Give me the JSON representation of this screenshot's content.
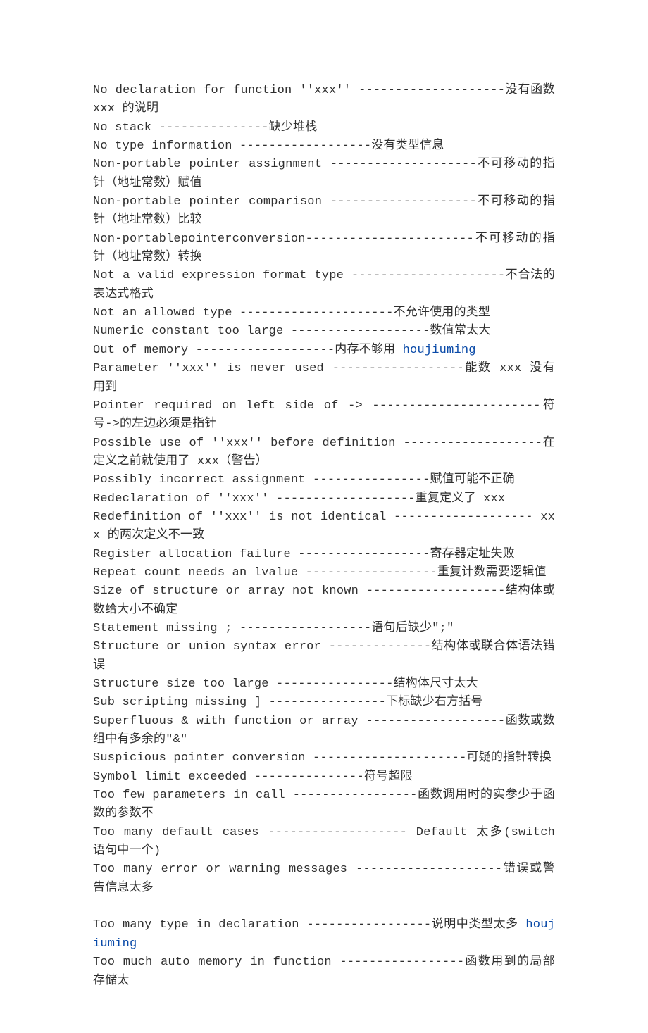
{
  "lines": [
    {
      "text": "No declaration for function ''xxx'' --------------------没有函数 xxx 的说明"
    },
    {
      "text": "No stack ---------------缺少堆栈"
    },
    {
      "text": "No type information ------------------没有类型信息"
    },
    {
      "text": "Non-portable pointer assignment --------------------不可移动的指针（地址常数）赋值"
    },
    {
      "text": "Non-portable pointer comparison --------------------不可移动的指针（地址常数）比较"
    },
    {
      "text": "Non-portablepointerconversion-----------------------不可移动的指针（地址常数）转换"
    },
    {
      "text": "Not a valid expression format type ---------------------不合法的表达式格式"
    },
    {
      "text": "Not an allowed type ---------------------不允许使用的类型"
    },
    {
      "text": "Numeric constant too large -------------------数值常太大"
    },
    {
      "text": "Out of memory -------------------内存不够用 ",
      "link": "houjiuming"
    },
    {
      "text": "Parameter ''xxx'' is never used ------------------能数 xxx 没有用到"
    },
    {
      "text": "Pointer required on left side of -> -----------------------符号->的左边必须是指针"
    },
    {
      "text": "Possible use of ''xxx'' before definition -------------------在定义之前就使用了 xxx（警告）"
    },
    {
      "text": "Possibly incorrect assignment ----------------赋值可能不正确"
    },
    {
      "text": "Redeclaration of ''xxx'' -------------------重复定义了 xxx"
    },
    {
      "text": "Redefinition of ''xxx'' is not identical ------------------- xxx 的两次定义不一致"
    },
    {
      "text": "Register allocation failure ------------------寄存器定址失败"
    },
    {
      "text": "Repeat count needs an lvalue ------------------重复计数需要逻辑值"
    },
    {
      "text": "Size of structure or array not known -------------------结构体或数给大小不确定"
    },
    {
      "text": "Statement missing ; ------------------语句后缺少\";\""
    },
    {
      "text": "Structure or union syntax error --------------结构体或联合体语法错误"
    },
    {
      "text": "Structure size too large ----------------结构体尺寸太大"
    },
    {
      "text": "Sub scripting missing ] ----------------下标缺少右方括号"
    },
    {
      "text": "Superfluous & with function or array -------------------函数或数组中有多余的\"&\""
    },
    {
      "text": "Suspicious pointer conversion ---------------------可疑的指针转换"
    },
    {
      "text": "Symbol limit exceeded ---------------符号超限"
    },
    {
      "text": "Too few parameters in call -----------------函数调用时的实参少于函数的参数不"
    },
    {
      "text": "Too many default cases ------------------- Default 太多(switch 语句中一个)"
    },
    {
      "text": "Too many error or warning messages --------------------错误或警告信息太多"
    },
    {
      "text": "",
      "blank": true
    },
    {
      "text": "Too many type in declaration -----------------说明中类型太多 ",
      "link": "houjiuming"
    },
    {
      "text": "Too much auto memory in function -----------------函数用到的局部存储太"
    }
  ]
}
